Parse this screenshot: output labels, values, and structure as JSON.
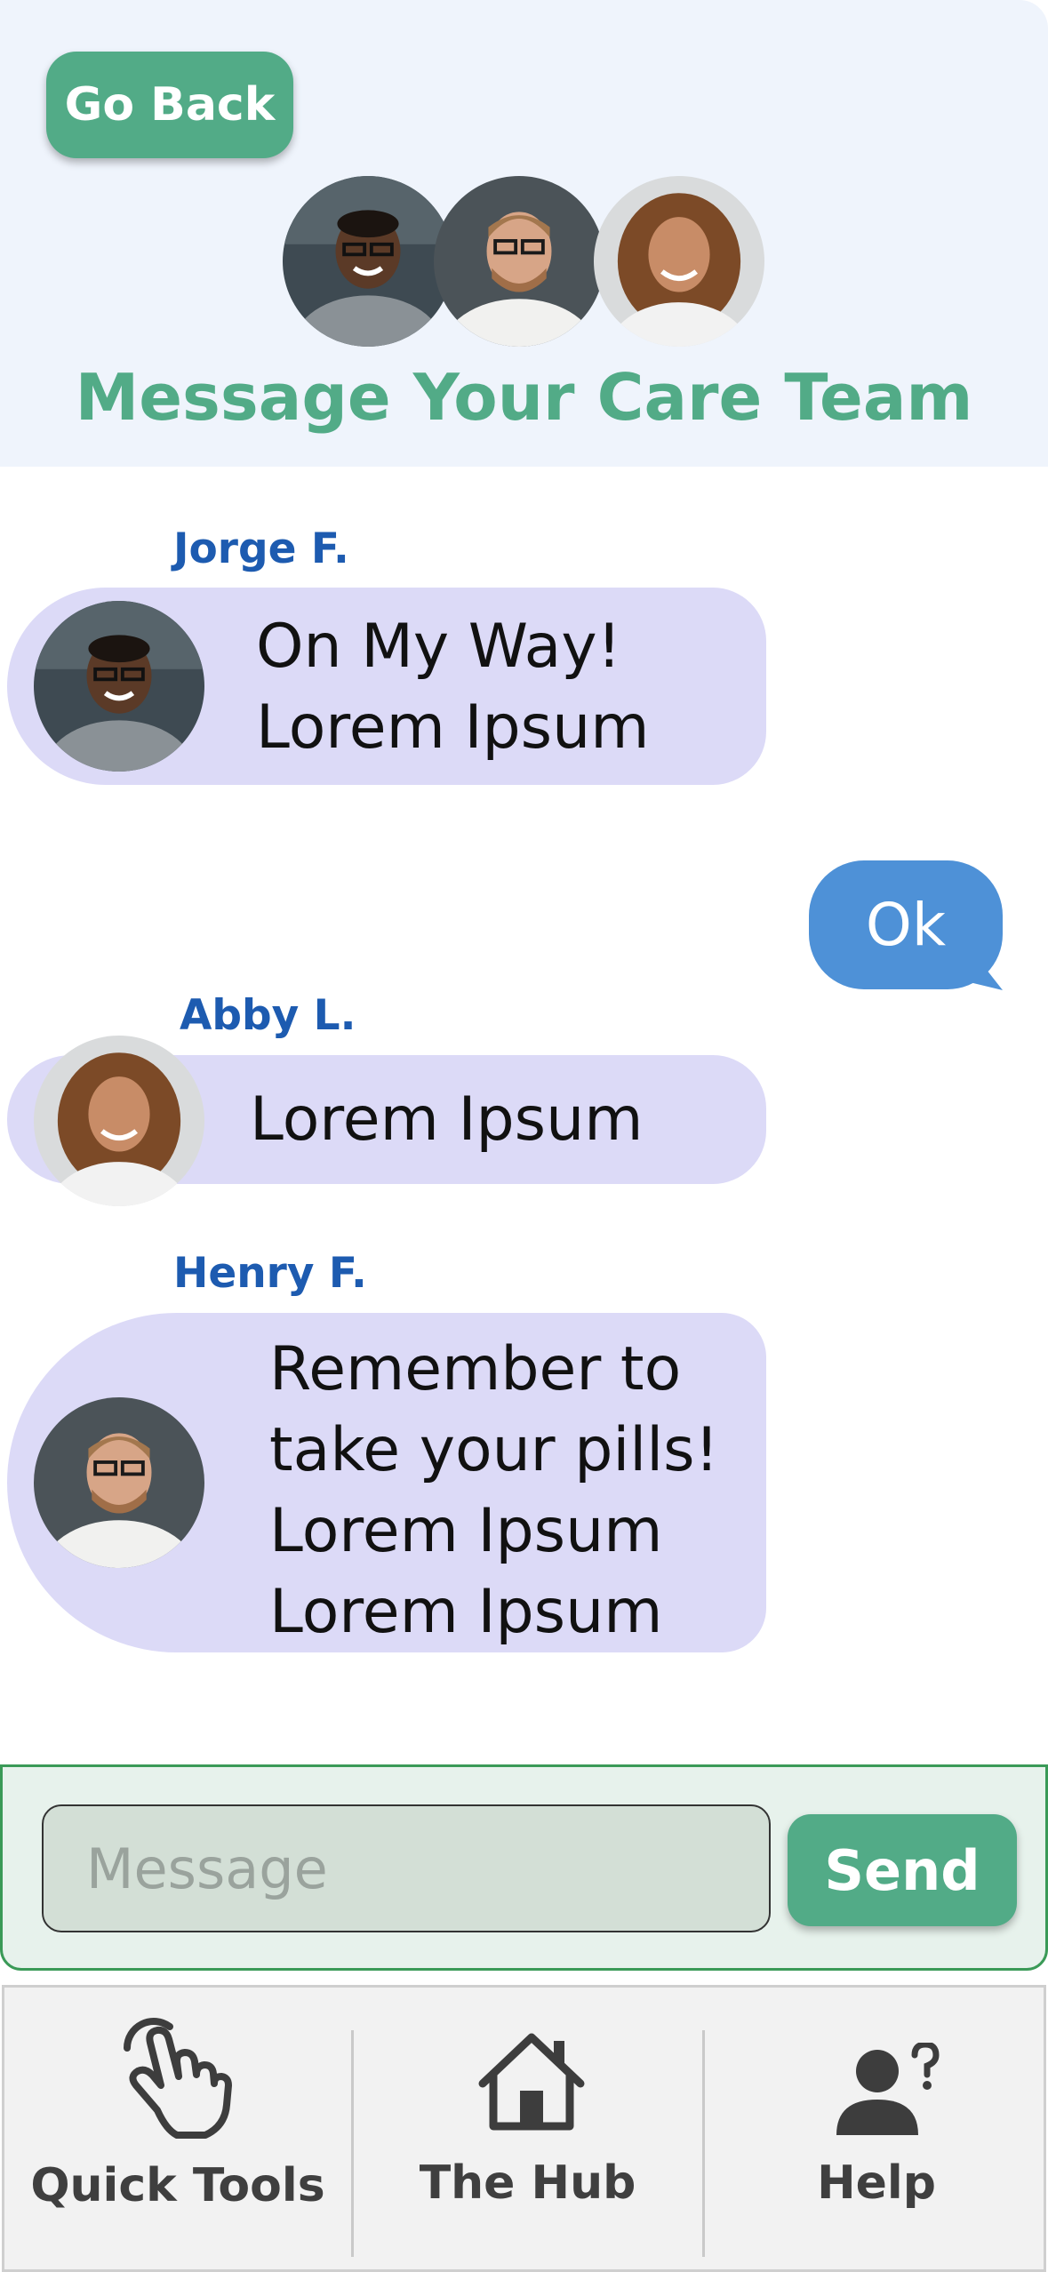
{
  "header": {
    "back_label": "Go Back",
    "title": "Message Your Care Team"
  },
  "messages": [
    {
      "sender": "Jorge F.",
      "text": "On My Way!\nLorem Ipsum"
    },
    {
      "sender": "Abby L.",
      "text": "Lorem Ipsum"
    },
    {
      "sender": "Henry F.",
      "text": "Remember to\ntake your pills!\nLorem Ipsum\nLorem Ipsum"
    }
  ],
  "reply": {
    "text": "Ok"
  },
  "compose": {
    "placeholder": "Message",
    "send_label": "Send"
  },
  "nav": {
    "quick_tools": "Quick Tools",
    "hub": "The Hub",
    "help": "Help"
  },
  "colors": {
    "accent_green": "#52ab87",
    "header_bg": "#eff4fc",
    "bubble_bg": "#dcdaf7",
    "reply_bg": "#4e91d7",
    "name_blue": "#1d5bb0"
  }
}
